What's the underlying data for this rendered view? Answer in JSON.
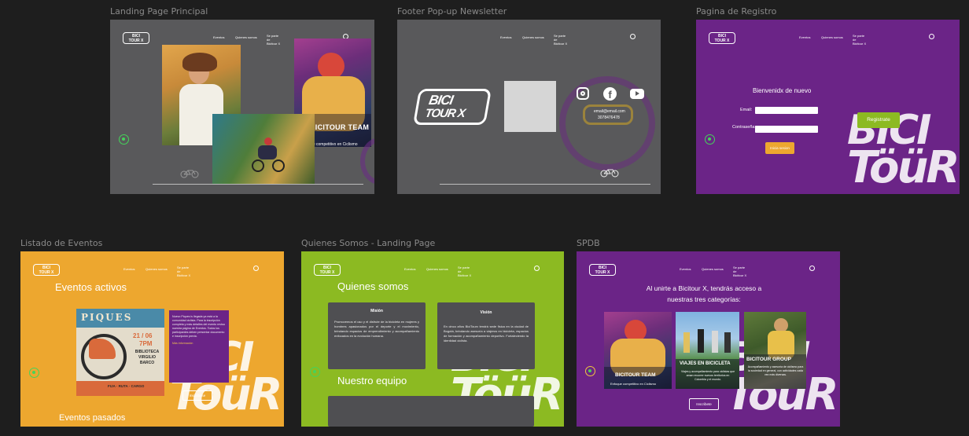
{
  "frames": {
    "landing": {
      "label": "Landing Page Principal",
      "nav": {
        "events": "Eventos",
        "about": "Quienes somos",
        "join": "Se parte de Bicitour X"
      },
      "hero_title": "BICITOUR TEAM",
      "hero_sub": "Enfoque competitivo en Ciclismo"
    },
    "footer": {
      "label": "Footer Pop-up Newsletter",
      "nav": {
        "events": "Eventos",
        "about": "Quienes somos",
        "join": "Se parte de Bicitour X"
      },
      "email": "email@email.com",
      "phone": "3078476478"
    },
    "registro": {
      "label": "Pagina de Registro",
      "nav": {
        "events": "Eventos",
        "about": "Quienes somos",
        "join": "Se parte de Bicitour X"
      },
      "welcome": "Bienvenidx de nuevo",
      "email_label": "Email:",
      "password_label": "Contraseña:",
      "login_btn": "Inicia sesion",
      "register_btn": "Registrate"
    },
    "eventos": {
      "label": "Listado de Eventos",
      "nav": {
        "events": "Eventos",
        "about": "Quienes somos",
        "join": "Se parte de Bicitour X"
      },
      "active_title": "Eventos activos",
      "poster_title": "PIQUES",
      "poster_date": "21 / 06",
      "poster_time": "7PM",
      "poster_place": "BIBLIOTECA VIRGILIO BARCO",
      "poster_cats": "FIJA · RUTA · CARGO",
      "event_desc": "Nuevo Piques is llegada ya está a la comunidad ciclista. Para la inscripción completa y más detalles del evento revisa nuestra página de Eventos. Todos los participantes deben presentar documento e inscripción previa.",
      "event_more": "Más información",
      "signup_btn": "Inscribirse",
      "past_title": "Eventos pasados"
    },
    "quienes": {
      "label": "Quienes Somos - Landing Page",
      "nav": {
        "events": "Eventos",
        "about": "Quienes somos",
        "join": "Se parte de Bicitour X"
      },
      "title": "Quienes somos",
      "mision_title": "Misión",
      "mision_text": "Promovemos el uso y el disfrute de la bicicleta en mujeres y hombres apasionados por el deporte y el movimiento, brindando espacios de emprendimiento y acompañamiento enfocados en la evolución humana.",
      "vision_title": "Visión",
      "vision_text": "En cinco años BiciTourx tendrá sede fisica en la ciudad de Bogotá, brindando asesoría a viajeros en bicicleta, espacios de formación y acompañamiento deportivo. Fortaleciendo la identidad ciclista.",
      "team_title": "Nuestro equipo"
    },
    "spdb": {
      "label": "SPDB",
      "nav": {
        "events": "Eventos",
        "about": "Quienes somos",
        "join": "Se parte de Bicitour X"
      },
      "headline_1": "Al unirte a Bicitour X, tendrás acceso a",
      "headline_2": "nuestras tres categorías:",
      "cards": [
        {
          "title": "BICITOUR TEAM",
          "text": "Enfoque competitivo en Ciclismo"
        },
        {
          "title": "VIAJES EN BICICLETA",
          "text": "Viajes y acompañamiento para ciclistas que aman recorrer nuevos territorios en Colombia y el mundo."
        },
        {
          "title": "BICITOUR GROUP",
          "text": "Acompañamiento y asesoría de ciclismo para la sociedad en general, con actividades cada vez más diversas."
        }
      ],
      "signup_btn": "Inscribete"
    }
  },
  "brand": {
    "logo_text_1": "BICI",
    "logo_text_2": "TOUR X",
    "big_1": "BICI",
    "big_2": "TöüR"
  },
  "colors": {
    "canvas": "#1e1e1e",
    "gray": "#59595b",
    "purple": "#6b2487",
    "orange": "#eda72f",
    "green": "#8cba22",
    "whatsapp": "#45d35a"
  },
  "icons": [
    "whatsapp-icon",
    "user-icon",
    "bike-icon",
    "instagram-icon",
    "facebook-icon",
    "youtube-icon"
  ]
}
